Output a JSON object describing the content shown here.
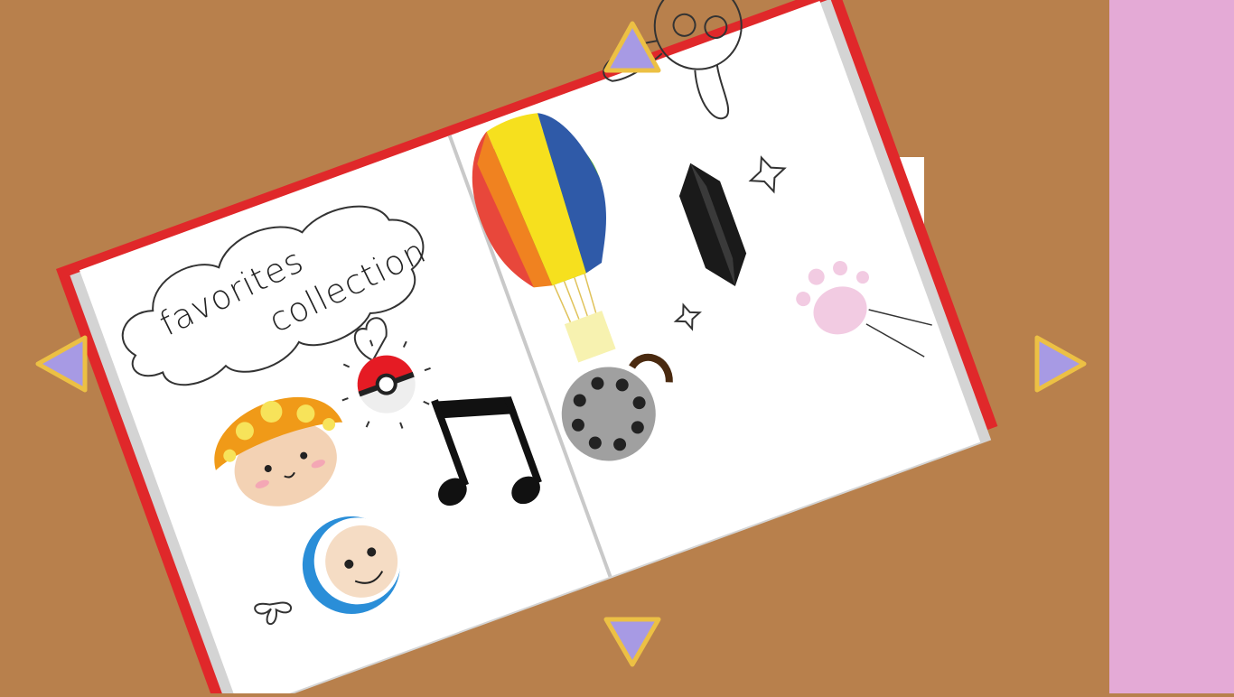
{
  "album": {
    "title_line1": "favorites",
    "title_line2": "collection"
  },
  "navigation": {
    "up": "arrow-up-icon",
    "down": "arrow-down-icon",
    "left": "arrow-left-icon",
    "right": "arrow-right-icon"
  },
  "stickers": [
    "mushroom-sticker",
    "pokeball-sticker",
    "music-note-sticker",
    "blue-hooded-face-sticker",
    "hot-air-balloon-sticker",
    "black-crystal-sticker",
    "gray-button-sticker",
    "pink-paw-sticker",
    "bunny-doodle",
    "heart-doodle",
    "butterfly-doodle"
  ],
  "colors": {
    "background": "#b8804c",
    "side_panel": "#e4aad6",
    "book_cover": "#e0282a",
    "page": "#ffffff",
    "arrow_fill": "#a79ae4",
    "arrow_stroke": "#ecc044",
    "tab_blue": "#7ac4f4"
  }
}
